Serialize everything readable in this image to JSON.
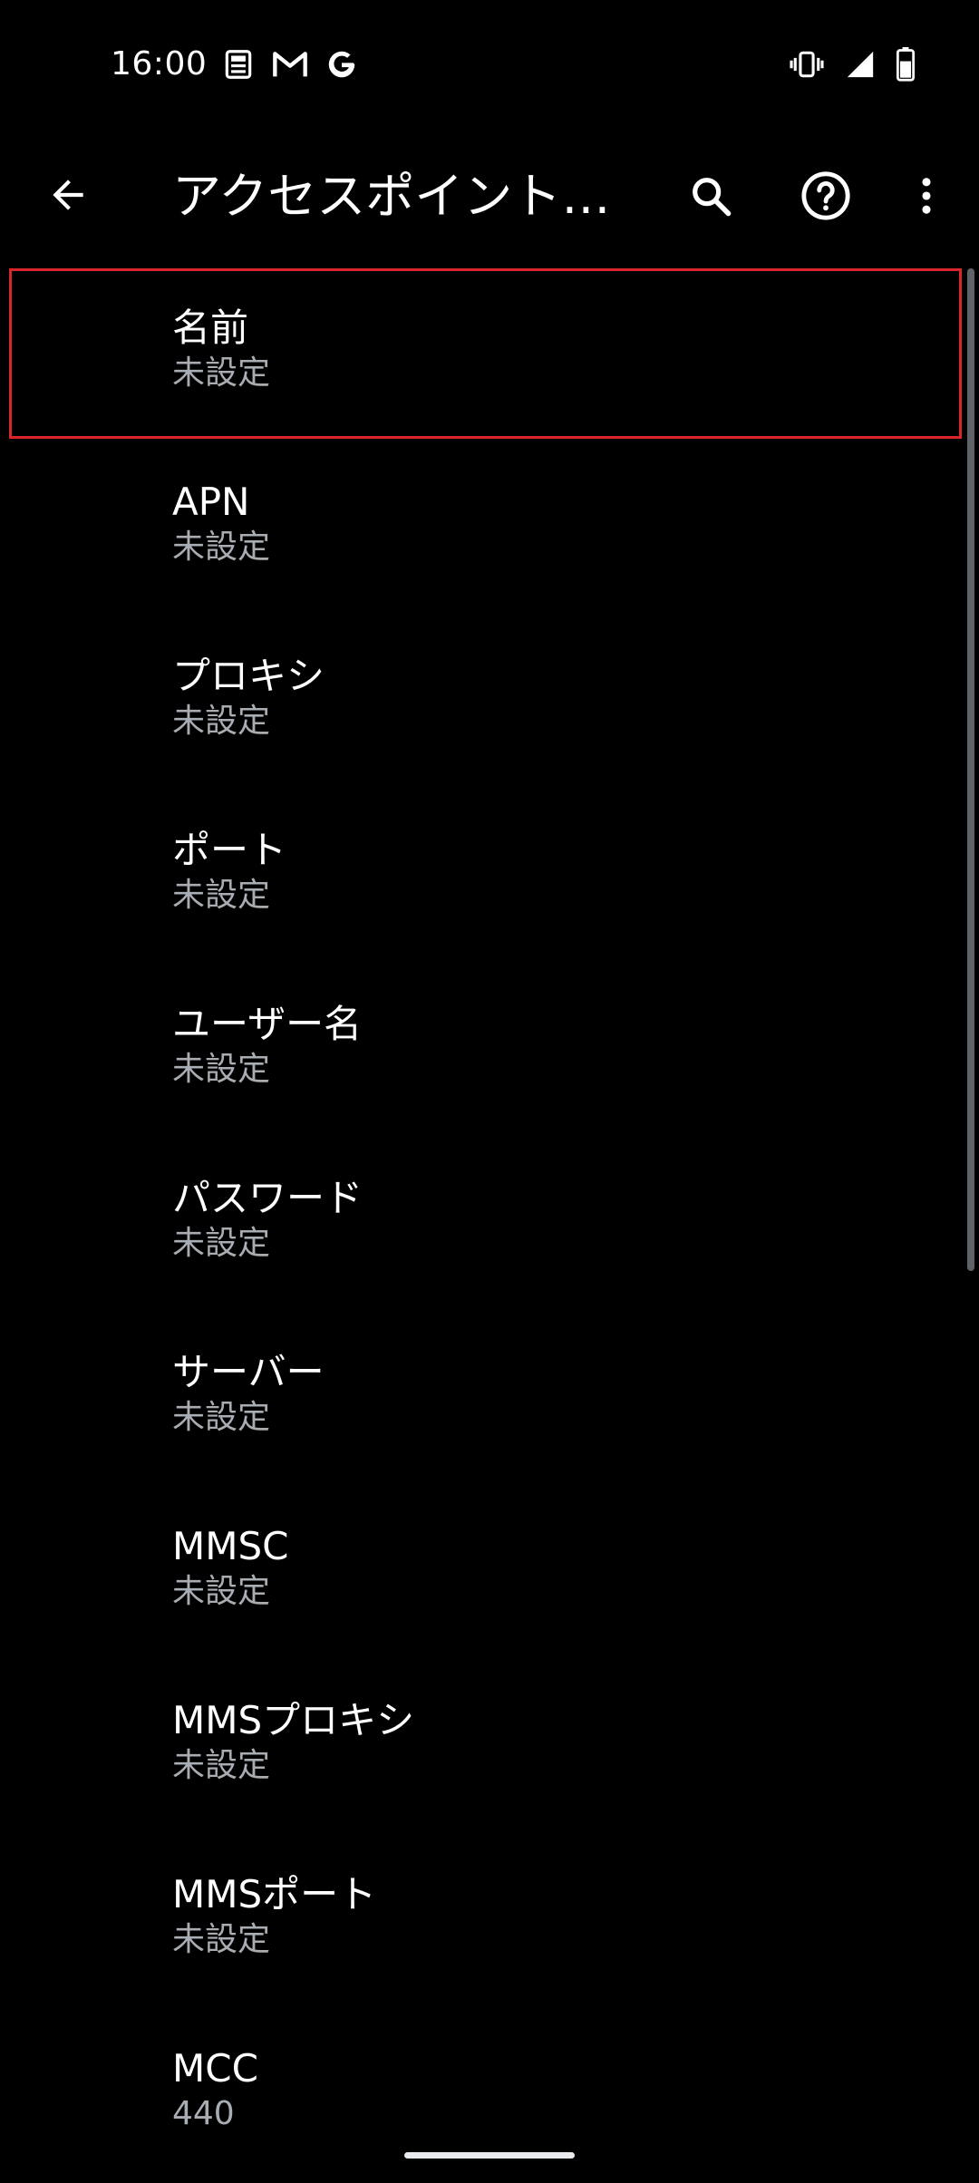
{
  "status_bar": {
    "time": "16:00"
  },
  "app_bar": {
    "title": "アクセスポイントの…"
  },
  "fields": [
    {
      "label": "名前",
      "value": "未設定"
    },
    {
      "label": "APN",
      "value": "未設定"
    },
    {
      "label": "プロキシ",
      "value": "未設定"
    },
    {
      "label": "ポート",
      "value": "未設定"
    },
    {
      "label": "ユーザー名",
      "value": "未設定"
    },
    {
      "label": "パスワード",
      "value": "未設定"
    },
    {
      "label": "サーバー",
      "value": "未設定"
    },
    {
      "label": "MMSC",
      "value": "未設定"
    },
    {
      "label": "MMSプロキシ",
      "value": "未設定"
    },
    {
      "label": "MMSポート",
      "value": "未設定"
    },
    {
      "label": "MCC",
      "value": "440"
    }
  ],
  "icons": {
    "status_left": [
      "news-icon",
      "gmail-icon",
      "google-icon"
    ],
    "status_right": [
      "vibrate-icon",
      "signal-icon",
      "battery-icon"
    ],
    "app_bar": [
      "back-arrow-icon",
      "search-icon",
      "help-icon",
      "more-vert-icon"
    ]
  },
  "colors": {
    "background": "#000000",
    "selection_border": "#d9262a",
    "secondary_text": "#a8adb3"
  }
}
